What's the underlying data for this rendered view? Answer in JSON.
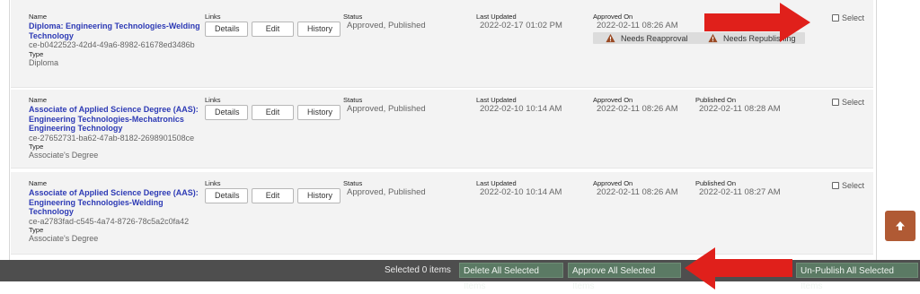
{
  "labels": {
    "name": "Name",
    "links": "Links",
    "status": "Status",
    "last_updated": "Last Updated",
    "approved_on": "Approved On",
    "published_on": "Published On",
    "type": "Type",
    "select": "Select"
  },
  "buttons": {
    "details": "Details",
    "edit": "Edit",
    "history": "History"
  },
  "rows": [
    {
      "title": "Diploma: Engineering Technologies-Welding Technology",
      "id": "ce-b0422523-42d4-49a6-8982-61678ed3486b",
      "type": "Diploma",
      "status": "Approved, Published",
      "last_updated": "2022-02-17 01:02 PM",
      "approved_on": "2022-02-11 08:26 AM",
      "approval_warning": "Needs Reapproval",
      "publish_warning": "Needs Republishing"
    },
    {
      "title": "Associate of Applied Science Degree (AAS): Engineering Technologies-Mechatronics Engineering Technology",
      "id": "ce-27652731-ba62-47ab-8182-2698901508ce",
      "type": "Associate's Degree",
      "status": "Approved, Published",
      "last_updated": "2022-02-10 10:14 AM",
      "approved_on": "2022-02-11 08:26 AM",
      "published_on": "2022-02-11 08:28 AM"
    },
    {
      "title": "Associate of Applied Science Degree (AAS): Engineering Technologies-Welding Technology",
      "id": "ce-a2783fad-c545-4a74-8726-78c5a2c0fa42",
      "type": "Associate's Degree",
      "status": "Approved, Published",
      "last_updated": "2022-02-10 10:14 AM",
      "approved_on": "2022-02-11 08:26 AM",
      "published_on": "2022-02-11 08:27 AM"
    }
  ],
  "bottom_bar": {
    "selected_count": "Selected 0 items",
    "delete_all": "Delete All Selected Items",
    "approve_all": "Approve All Selected Items",
    "unpublish_all": "Un-Publish All Selected Items"
  },
  "colors": {
    "link": "#2d3ab5",
    "arrow": "#e0201b",
    "bar": "#4e4e4e",
    "action": "#5b7a64",
    "scroll_top": "#b05a34"
  },
  "icons": {
    "warning": "warning-triangle-icon",
    "scroll_top": "arrow-up-icon"
  }
}
